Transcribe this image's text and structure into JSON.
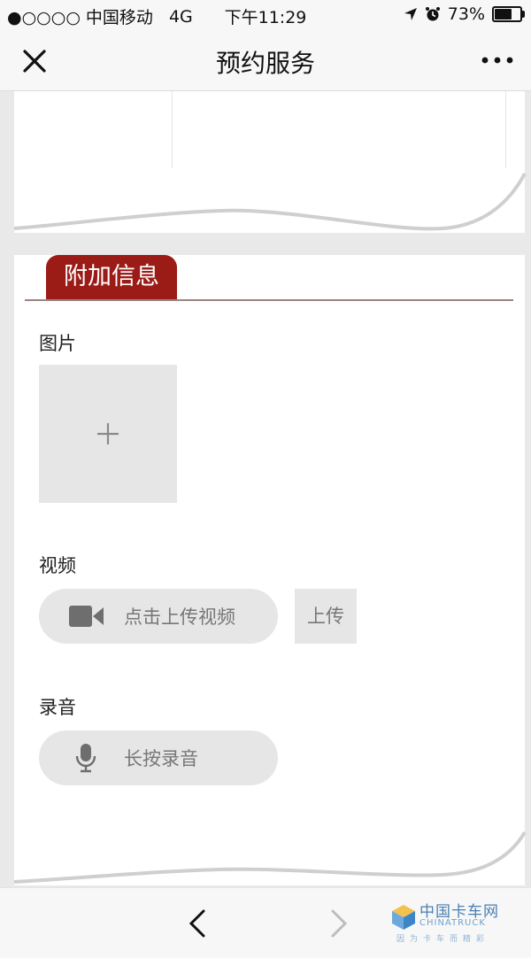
{
  "status_bar": {
    "carrier": "●○○○○ 中国移动",
    "network": "4G",
    "time": "下午11:29",
    "battery": "73%",
    "battery_level": 0.73
  },
  "nav_bar": {
    "title": "预约服务",
    "close_icon": "close-icon",
    "more_icon": "more-icon"
  },
  "section": {
    "title": "附加信息",
    "photo_label": "图片",
    "video_label": "视频",
    "video_placeholder": "点击上传视频",
    "upload_label": "上传",
    "audio_label": "录音",
    "audio_placeholder": "长按录音"
  },
  "watermark": {
    "name": "中国卡车网",
    "latin": "CHINATRUCK",
    "tagline": "因为卡车而精彩"
  },
  "colors": {
    "accent": "#9b1b17",
    "background": "#e9e9e9",
    "card": "#ffffff",
    "placeholder": "#e6e6e6"
  }
}
